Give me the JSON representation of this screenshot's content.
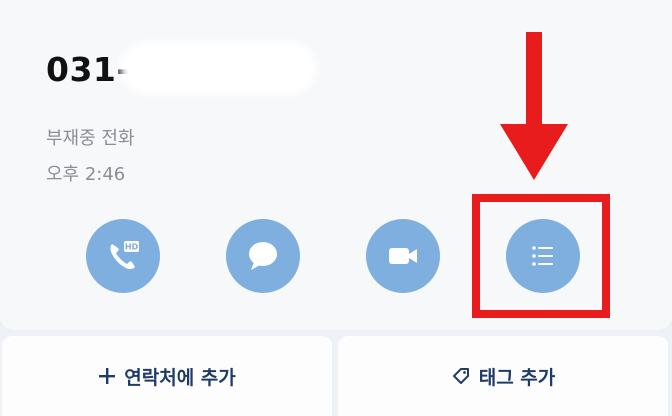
{
  "call": {
    "phone_number": "031-",
    "call_type": "부재중 전화",
    "time": "오후 2:46"
  },
  "actions": [
    {
      "name": "hd-voice-call",
      "icon": "phone-hd-icon",
      "badge": "HD"
    },
    {
      "name": "message",
      "icon": "chat-bubble-icon"
    },
    {
      "name": "video-call",
      "icon": "video-camera-icon"
    },
    {
      "name": "details",
      "icon": "list-icon"
    }
  ],
  "bottom": {
    "add_contact_label": "연락처에 추가",
    "add_tag_label": "태그 추가"
  },
  "colors": {
    "action_button": "#7fafdf",
    "highlight_red": "#e81c1c",
    "bottom_text": "#1f3c66",
    "secondary_text": "#8a8f96"
  }
}
